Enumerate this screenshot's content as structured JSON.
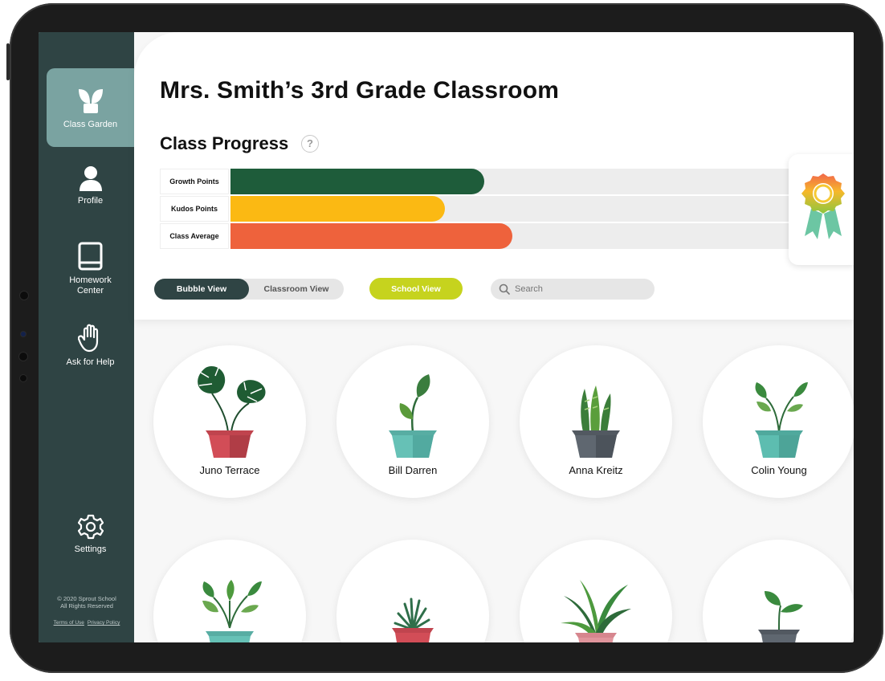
{
  "classroom": {
    "title": "Mrs. Smith’s 3rd Grade Classroom"
  },
  "sidebar": {
    "items": [
      {
        "label": "Class Garden",
        "icon": "sprout-icon",
        "active": true
      },
      {
        "label": "Profile",
        "icon": "user-icon",
        "active": false
      },
      {
        "label": "Homework\nCenter",
        "icon": "book-icon",
        "active": false
      },
      {
        "label": "Ask for Help",
        "icon": "raised-hand-icon",
        "active": false
      },
      {
        "label": "Settings",
        "icon": "gear-icon",
        "active": false
      }
    ],
    "copyright": "© 2020 Sprout School\nAll Rights Reserved",
    "terms_link": "Terms of Use",
    "privacy_link": "Privacy Policy"
  },
  "progress": {
    "heading": "Class Progress",
    "help_icon": "?",
    "rows": [
      {
        "label": "Growth Points",
        "fraction": 0.45,
        "color": "#1e5c3a"
      },
      {
        "label": "Kudos Points",
        "fraction": 0.38,
        "color": "#fbb913"
      },
      {
        "label": "Class Average",
        "fraction": 0.5,
        "color": "#ee623c"
      }
    ],
    "award_icon": "award-ribbon-icon"
  },
  "controls": {
    "view_toggle": [
      "Bubble View",
      "Classroom View"
    ],
    "selected_view": "Bubble View",
    "school_view_label": "School View",
    "search_placeholder": "Search"
  },
  "students": [
    {
      "name": "Juno Terrace",
      "plant": "monstera",
      "pot_color": "#d24d57"
    },
    {
      "name": "Bill Darren",
      "plant": "sprout",
      "pot_color": "#66c1b6"
    },
    {
      "name": "Anna Kreitz",
      "plant": "snake-plant",
      "pot_color": "#5f6770"
    },
    {
      "name": "Colin Young",
      "plant": "leafy",
      "pot_color": "#5dbdb0"
    },
    {
      "name": "",
      "plant": "leafy-bush",
      "pot_color": "#66c1b6"
    },
    {
      "name": "",
      "plant": "succulent",
      "pot_color": "#d24d57"
    },
    {
      "name": "",
      "plant": "spider-plant",
      "pot_color": "#e0959c"
    },
    {
      "name": "",
      "plant": "seedling",
      "pot_color": "#5f6770"
    }
  ],
  "colors": {
    "sidebar": "#2f4444",
    "sidebar_active": "#7aa3a1",
    "accent": "#c6d31e"
  }
}
